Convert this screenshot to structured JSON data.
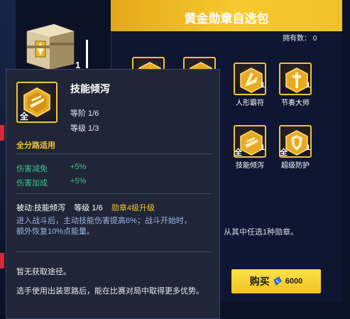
{
  "panel": {
    "title": "黄金勋章自选包",
    "own_count": "拥有数： 0",
    "description_tail": "从其中任选1种勋章。",
    "buy": {
      "label": "购买",
      "price": "6000"
    }
  },
  "left_item": {
    "count": "1"
  },
  "badges": [
    {
      "name": "人形霸符",
      "qty": "1",
      "icon": "humanoid-badge-icon"
    },
    {
      "name": "节奏大师",
      "qty": "1",
      "icon": "rhythm-master-badge-icon"
    },
    {
      "name": "技能倾泻",
      "qty": "1",
      "quan": "全",
      "icon": "skill-pour-badge-icon"
    },
    {
      "name": "超级防护",
      "qty": "1",
      "quan": "全",
      "icon": "super-defense-badge-icon"
    }
  ],
  "tooltip": {
    "name": "技能倾泻",
    "icon_badge": "全",
    "tier": "等阶 1/6",
    "level": "等级 1/3",
    "scope": "全分路适用",
    "stats": [
      {
        "label": "伤害减免",
        "value": "+5%"
      },
      {
        "label": "伤害加成",
        "value": "+5%"
      }
    ],
    "skill": {
      "passive": "被动:技能倾泻",
      "level": "等级 1/6",
      "upgrade": "勋章4级升级",
      "desc": "进入战斗后，主动技能伤害提高6%；战斗开始时，额外恢复10%点能量。"
    },
    "source": "暂无获取途径。",
    "tip": "选手使用出装思路后，能在比赛对局中取得更多优势。"
  },
  "colors": {
    "gold": "#f3c33a",
    "green": "#3bc38f",
    "skill_blue": "#9db3e6",
    "buy_yellow": "#f6cf2e"
  }
}
